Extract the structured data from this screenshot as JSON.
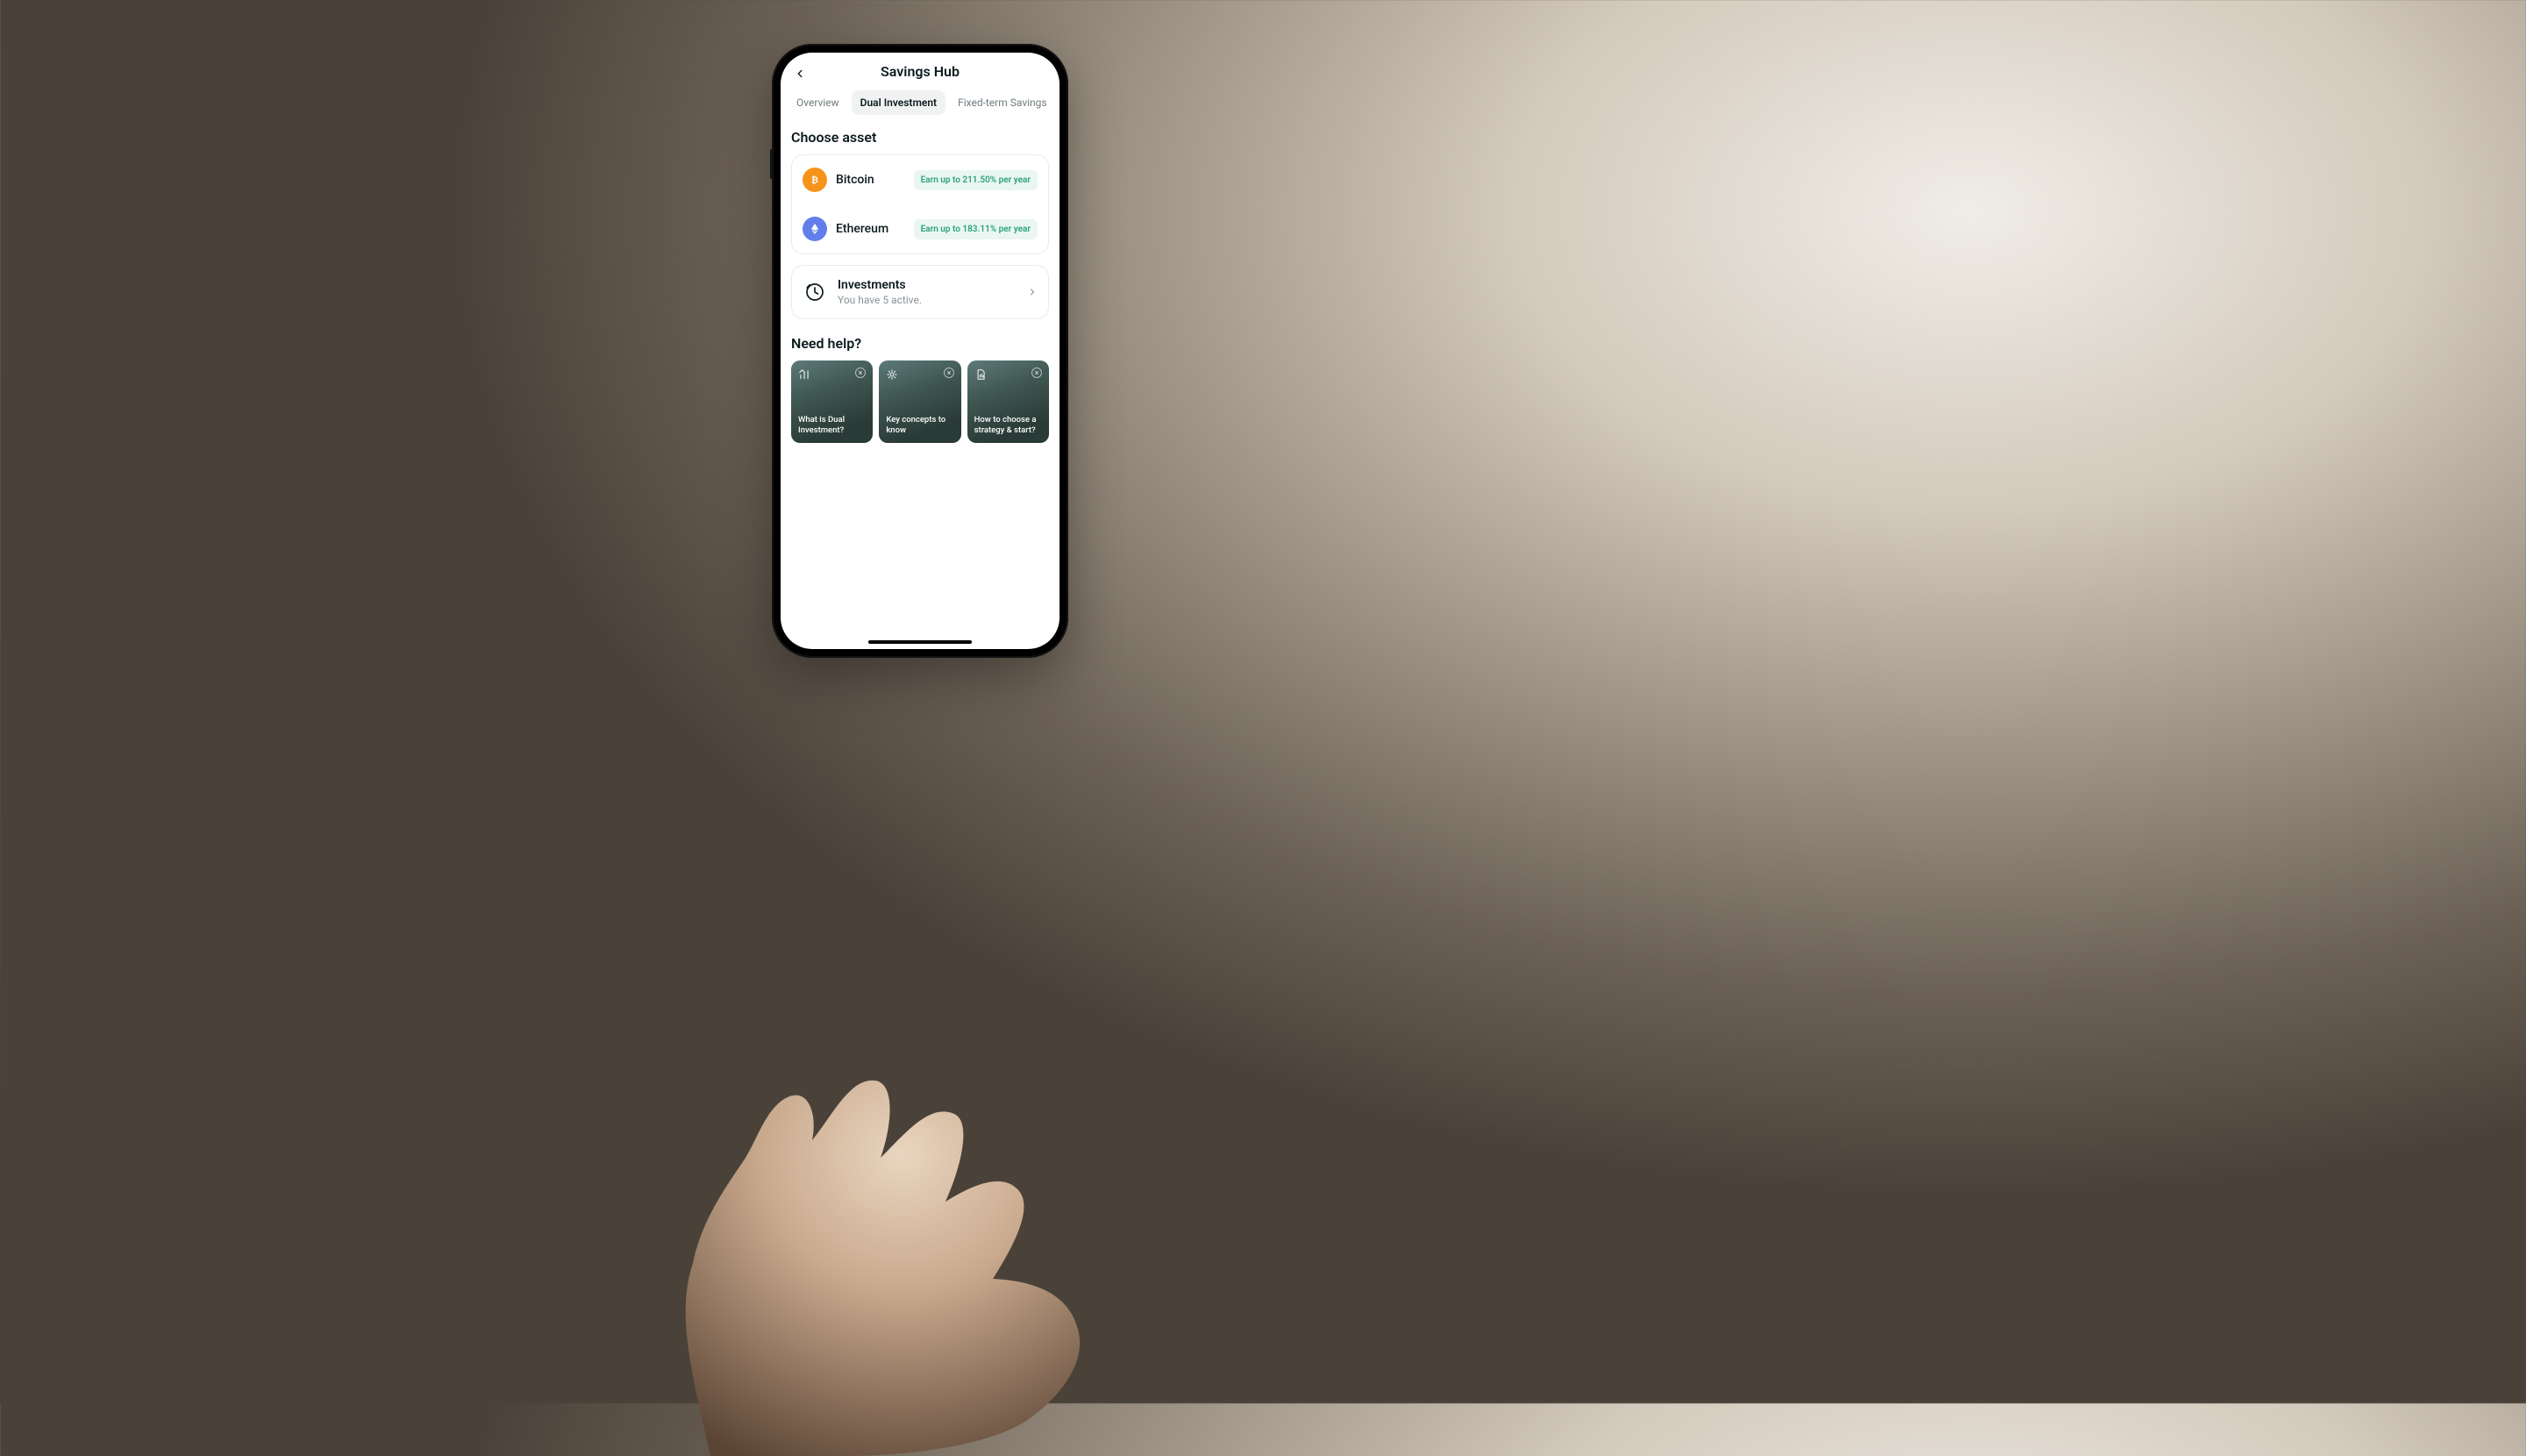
{
  "header": {
    "title": "Savings Hub"
  },
  "tabs": [
    {
      "label": "Overview",
      "active": false
    },
    {
      "label": "Dual Investment",
      "active": true
    },
    {
      "label": "Fixed-term Savings",
      "active": false
    }
  ],
  "choose_asset": {
    "title": "Choose asset",
    "assets": [
      {
        "name": "Bitcoin",
        "earn_label": "Earn up to 211.50% per year",
        "coin": "btc"
      },
      {
        "name": "Ethereum",
        "earn_label": "Earn up to 183.11% per year",
        "coin": "eth"
      }
    ]
  },
  "investments": {
    "title": "Investments",
    "subtitle": "You have 5 active."
  },
  "help": {
    "title": "Need help?",
    "cards": [
      {
        "label": "What is Dual Investment?"
      },
      {
        "label": "Key concepts to know"
      },
      {
        "label": "How to choose a strategy & start?"
      }
    ]
  }
}
